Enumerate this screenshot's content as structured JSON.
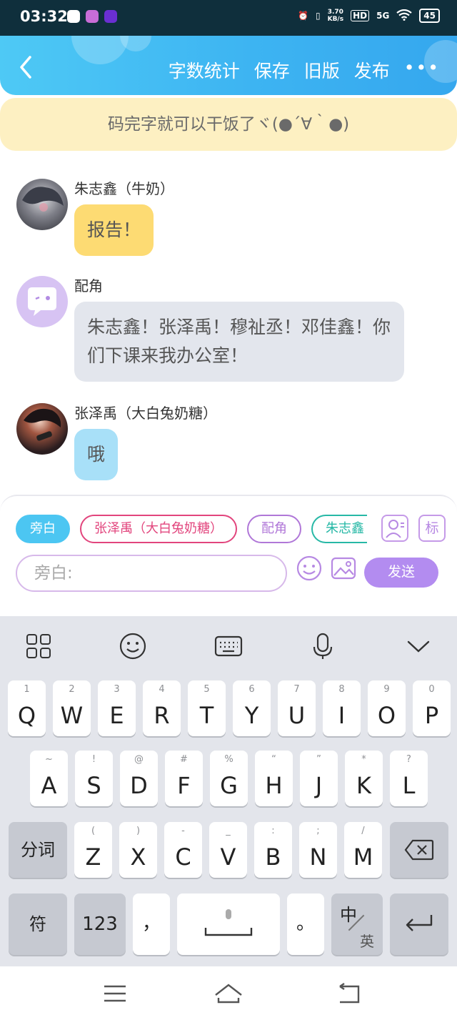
{
  "status": {
    "time": "03:32",
    "net_speed_value": "3.70",
    "net_speed_unit": "KB/s",
    "hd": "HD",
    "network": "5G",
    "battery": "45"
  },
  "header": {
    "actions": [
      "字数统计",
      "保存",
      "旧版",
      "发布"
    ],
    "more": "•••"
  },
  "notice": "码完字就可以干饭了ヾ(●´∀｀●)",
  "messages": [
    {
      "sender": "朱志鑫（牛奶）",
      "text": "报告！",
      "bubble_color": "#fddb73"
    },
    {
      "sender": "配角",
      "text": "朱志鑫！张泽禹！穆祉丞！邓佳鑫！你们下课来我办公室！",
      "bubble_color": "#e3e6ed"
    },
    {
      "sender": "张泽禹（大白兔奶糖）",
      "text": "哦",
      "bubble_color": "#a8e0f8"
    }
  ],
  "composer": {
    "roles": [
      "旁白",
      "张泽禹（大白兔奶糖）",
      "配角",
      "朱志鑫"
    ],
    "tag_button": "标",
    "input_placeholder": "旁白:",
    "send_label": "发送"
  },
  "keyboard": {
    "row1": [
      [
        "1",
        "Q"
      ],
      [
        "2",
        "W"
      ],
      [
        "3",
        "E"
      ],
      [
        "4",
        "R"
      ],
      [
        "5",
        "T"
      ],
      [
        "6",
        "Y"
      ],
      [
        "7",
        "U"
      ],
      [
        "8",
        "I"
      ],
      [
        "9",
        "O"
      ],
      [
        "0",
        "P"
      ]
    ],
    "row2": [
      [
        "~",
        "A"
      ],
      [
        "!",
        "S"
      ],
      [
        "@",
        "D"
      ],
      [
        "#",
        "F"
      ],
      [
        "%",
        "G"
      ],
      [
        "“",
        "H"
      ],
      [
        "”",
        "J"
      ],
      [
        "*",
        "K"
      ],
      [
        "?",
        "L"
      ]
    ],
    "row3": [
      [
        "(",
        "Z"
      ],
      [
        ")",
        "X"
      ],
      [
        "-",
        "C"
      ],
      [
        "_",
        "V"
      ],
      [
        ":",
        "B"
      ],
      [
        ";",
        "N"
      ],
      [
        "/",
        "M"
      ]
    ],
    "segment_label": "分词",
    "symbol_label": "符",
    "numbers_label": "123",
    "comma": "，",
    "period": "。",
    "lang_main": "中",
    "lang_alt": "英"
  }
}
